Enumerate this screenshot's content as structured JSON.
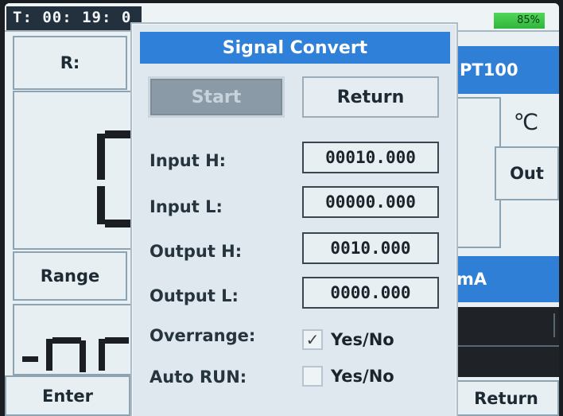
{
  "status": {
    "time": "T: 00: 19: 0",
    "battery": "85%"
  },
  "background": {
    "r_label": "R:",
    "sensor": "PT100",
    "unit": "℃",
    "out_button": "Out",
    "range_label": "Range",
    "output_unit": "mA",
    "enter_button": "Enter",
    "return_button": "Return"
  },
  "dialog": {
    "title": "Signal Convert",
    "start_button": "Start",
    "return_button": "Return",
    "fields": [
      {
        "label": "Input H:",
        "value": "00010.000"
      },
      {
        "label": "Input L:",
        "value": "00000.000"
      },
      {
        "label": "Output H:",
        "value": "0010.000"
      },
      {
        "label": "Output L:",
        "value": "0000.000"
      }
    ],
    "options": [
      {
        "label": "Overrange:",
        "checked": true,
        "text": "Yes/No",
        "mark": "✓"
      },
      {
        "label": "Auto RUN:",
        "checked": false,
        "text": "Yes/No",
        "mark": ""
      }
    ]
  },
  "colors": {
    "title_bar": "#2f80d9",
    "battery": "#3fc447"
  }
}
